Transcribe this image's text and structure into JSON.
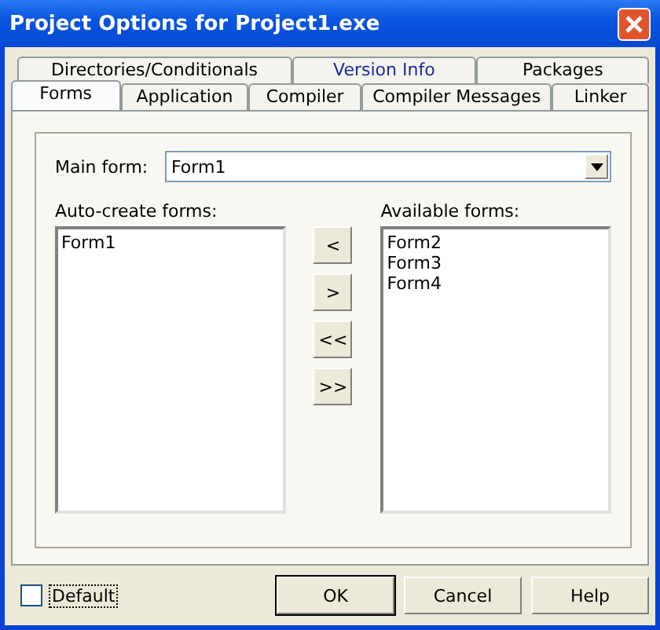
{
  "window": {
    "title": "Project Options for Project1.exe"
  },
  "tab_rows": [
    [
      {
        "label": "Directories/Conditionals",
        "selected": false,
        "hot": false
      },
      {
        "label": "Version Info",
        "selected": false,
        "hot": true
      },
      {
        "label": "Packages",
        "selected": false,
        "hot": false
      }
    ],
    [
      {
        "label": "Forms",
        "selected": true,
        "hot": false
      },
      {
        "label": "Application",
        "selected": false,
        "hot": false
      },
      {
        "label": "Compiler",
        "selected": false,
        "hot": false
      },
      {
        "label": "Compiler Messages",
        "selected": false,
        "hot": false
      },
      {
        "label": "Linker",
        "selected": false,
        "hot": false
      }
    ]
  ],
  "main_form": {
    "label": "Main form:",
    "value": "Form1"
  },
  "auto_create": {
    "label": "Auto-create forms:",
    "items": [
      "Form1"
    ]
  },
  "available": {
    "label": "Available forms:",
    "items": [
      "Form2",
      "Form3",
      "Form4"
    ]
  },
  "move_buttons": [
    "<",
    ">",
    "<<",
    ">>"
  ],
  "default_checkbox": {
    "label": "Default",
    "checked": false
  },
  "buttons": [
    {
      "label": "OK",
      "default": true
    },
    {
      "label": "Cancel",
      "default": false
    },
    {
      "label": "Help",
      "default": false
    }
  ]
}
